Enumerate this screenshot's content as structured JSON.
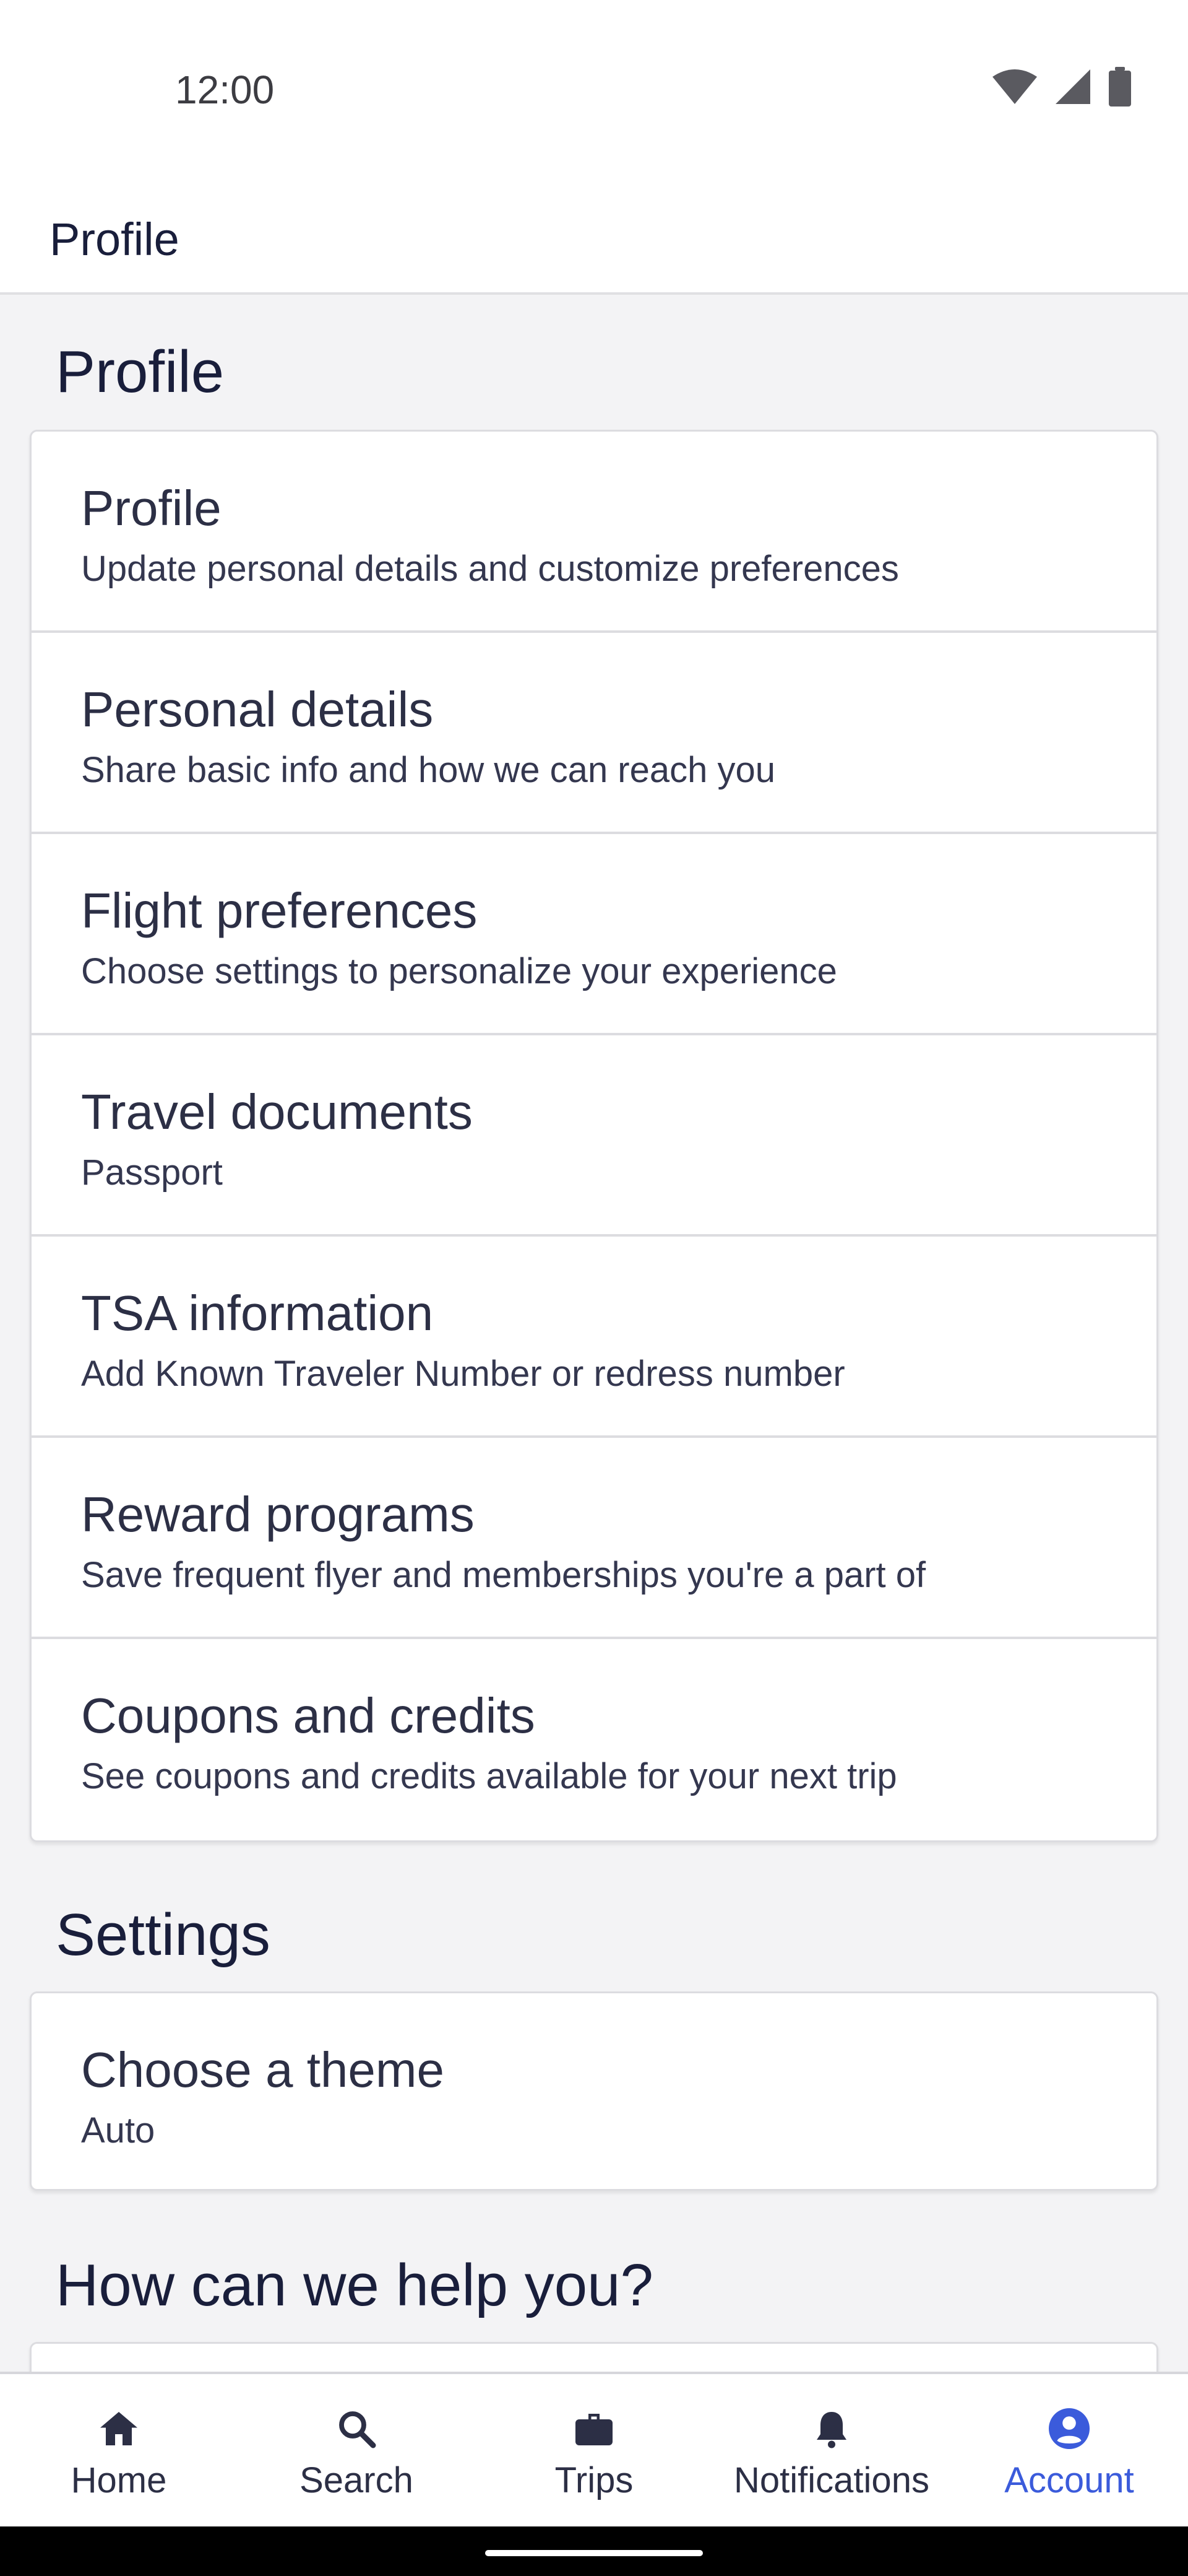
{
  "status_bar": {
    "time": "12:00"
  },
  "app_bar": {
    "title": "Profile"
  },
  "sections": {
    "profile": {
      "title": "Profile",
      "items": [
        {
          "title": "Profile",
          "subtitle": "Update personal details and customize preferences"
        },
        {
          "title": "Personal details",
          "subtitle": "Share basic info and how we can reach you"
        },
        {
          "title": "Flight preferences",
          "subtitle": "Choose settings to personalize your experience"
        },
        {
          "title": "Travel documents",
          "subtitle": "Passport"
        },
        {
          "title": "TSA information",
          "subtitle": "Add Known Traveler Number or redress number"
        },
        {
          "title": "Reward programs",
          "subtitle": "Save frequent flyer and memberships you're a part of"
        },
        {
          "title": "Coupons and credits",
          "subtitle": "See coupons and credits available for your next trip"
        }
      ]
    },
    "settings": {
      "title": "Settings",
      "items": [
        {
          "title": "Choose a theme",
          "subtitle": "Auto"
        }
      ]
    },
    "help": {
      "title": "How can we help you?"
    }
  },
  "bottom_nav": {
    "items": [
      {
        "label": "Home",
        "icon": "home-icon"
      },
      {
        "label": "Search",
        "icon": "search-icon"
      },
      {
        "label": "Trips",
        "icon": "briefcase-icon"
      },
      {
        "label": "Notifications",
        "icon": "bell-icon"
      },
      {
        "label": "Account",
        "icon": "account-icon"
      }
    ],
    "active": "Account"
  },
  "colors": {
    "accent": "#3b5bdb",
    "text": "#191e3b",
    "background": "#f3f3f5"
  }
}
